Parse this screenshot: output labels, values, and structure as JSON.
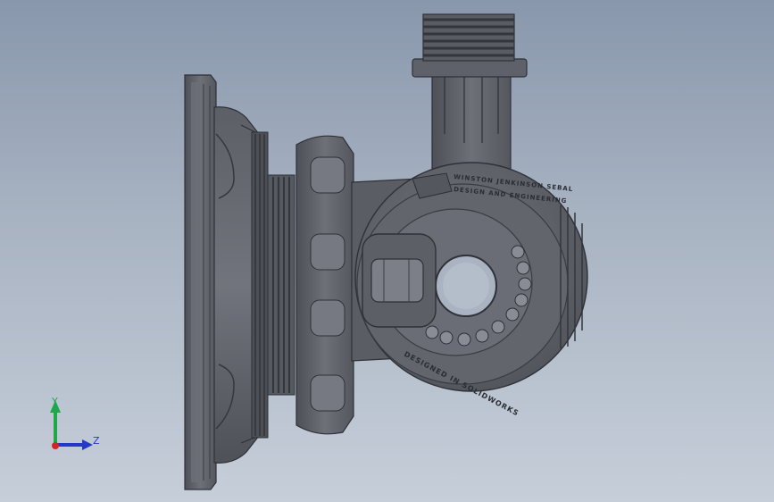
{
  "viewport": {
    "background_top": "#8997ac",
    "background_bottom": "#c6ced9",
    "model_body_color": "#62646c",
    "model_shade_color": "#3c3e45"
  },
  "engravings": {
    "company_line1": "WINSTON JENKINSON SEBAL",
    "company_line2": "DESIGN AND ENGINEERING",
    "bottom_text": "DESIGNED IN SOLIDWORKS"
  },
  "triad": {
    "y_label": "Y",
    "z_label": "Z",
    "y_color": "#1fa84a",
    "z_color": "#2638c6",
    "x_color": "#d0262b"
  }
}
